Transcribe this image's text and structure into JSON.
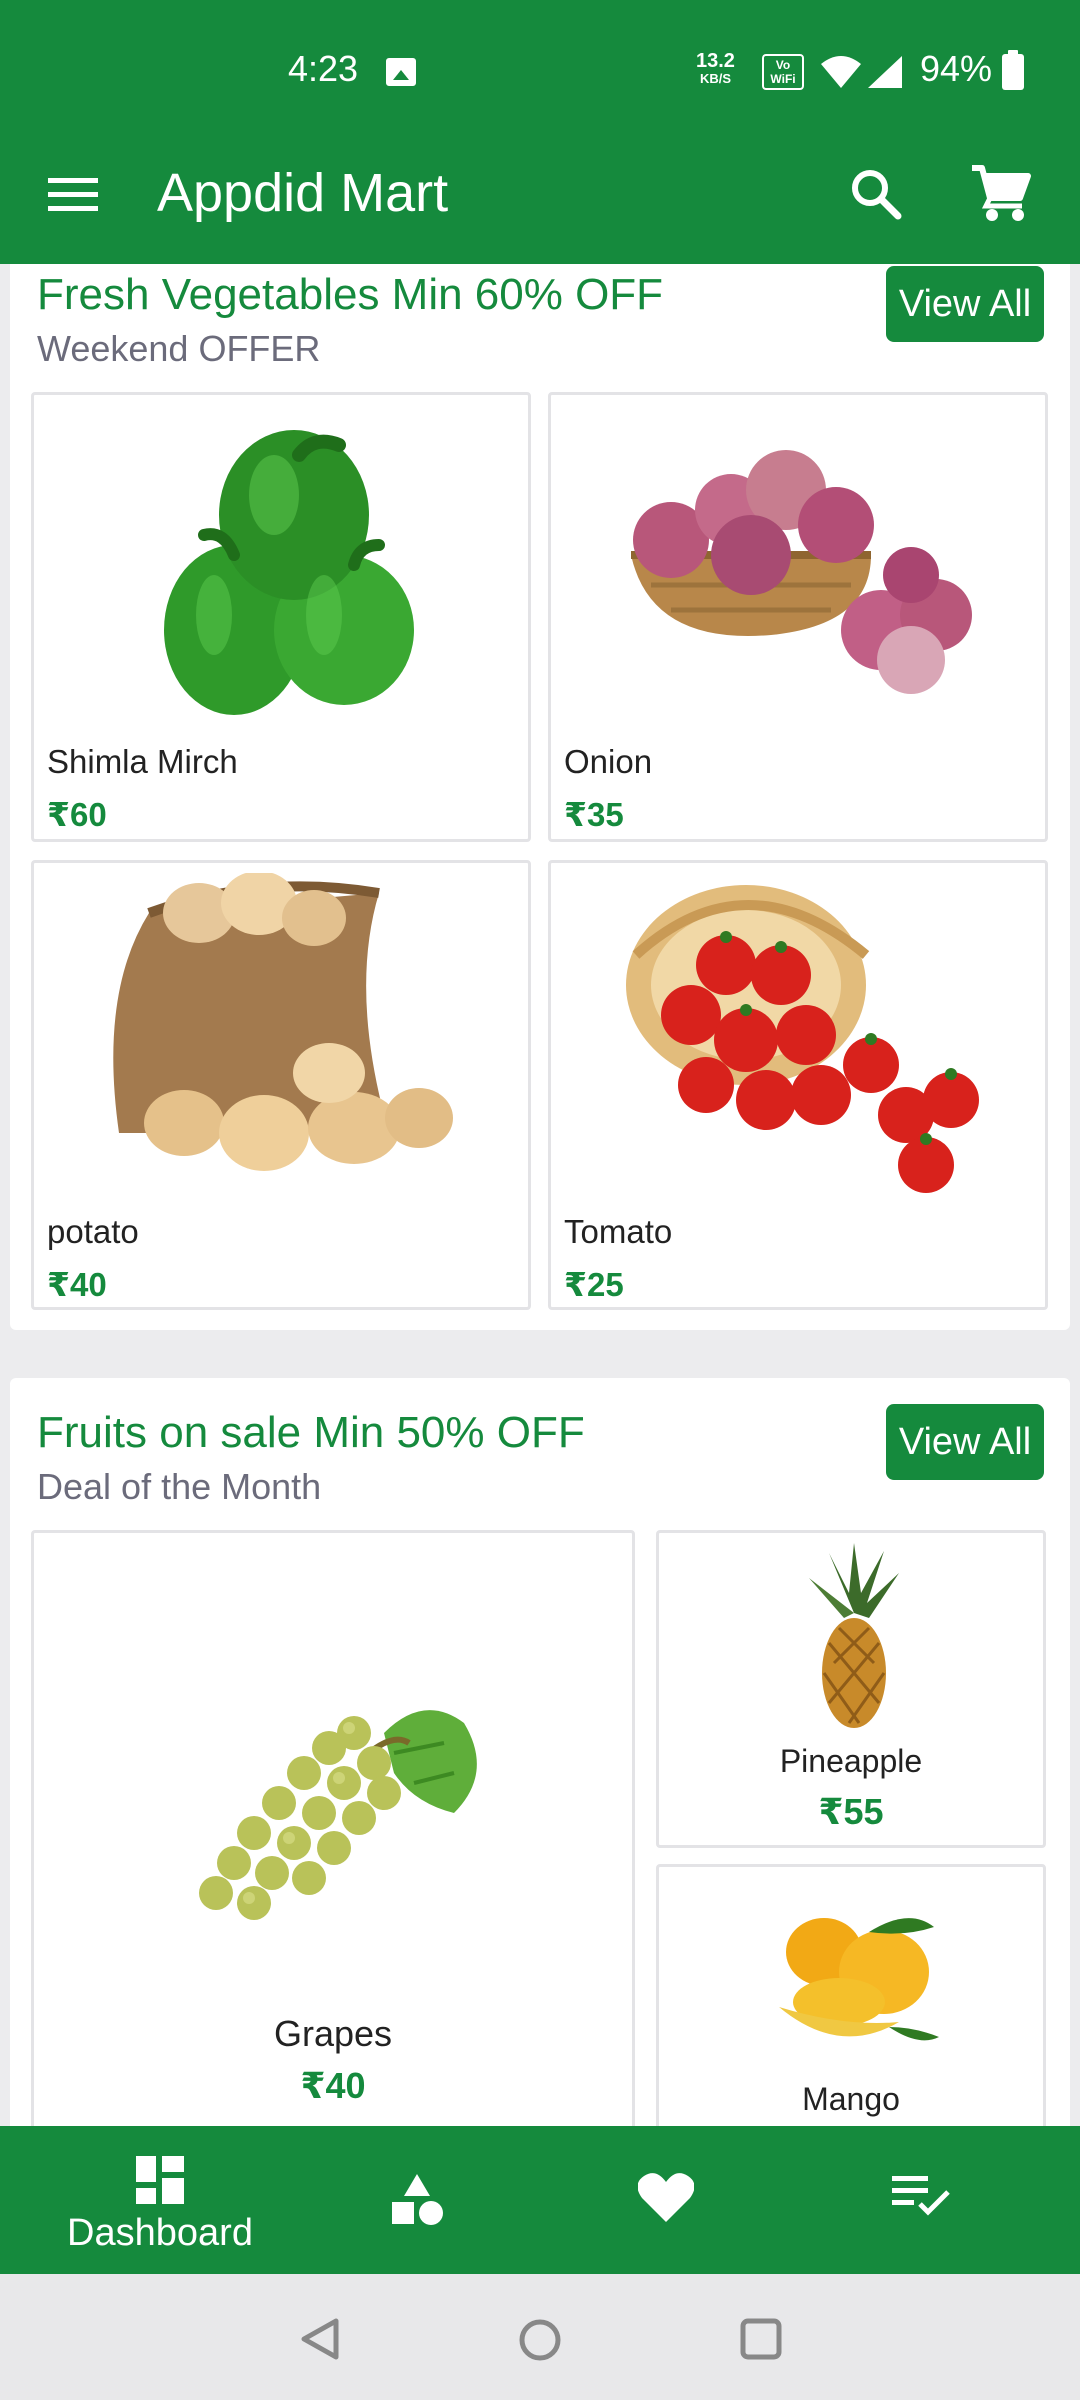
{
  "status_bar": {
    "time": "4:23",
    "net_speed_value": "13.2",
    "net_speed_unit": "KB/S",
    "wifi_badge": "Vo WiFi",
    "battery": "94%"
  },
  "app_bar": {
    "title": "Appdid Mart",
    "icons": [
      "menu-icon",
      "search-icon",
      "cart-icon"
    ]
  },
  "sections": [
    {
      "title": "Fresh Vegetables Min 60% OFF",
      "subtitle": "Weekend OFFER",
      "view_all": "View All",
      "products": [
        {
          "name": "Shimla Mirch",
          "price": "₹60"
        },
        {
          "name": "Onion",
          "price": "₹35"
        },
        {
          "name": "potato",
          "price": "₹40"
        },
        {
          "name": "Tomato",
          "price": "₹25"
        }
      ]
    },
    {
      "title": "Fruits on sale Min 50% OFF",
      "subtitle": "Deal of the Month",
      "view_all": "View All",
      "products": [
        {
          "name": "Grapes",
          "price": "₹40"
        },
        {
          "name": "Pineapple",
          "price": "₹55"
        },
        {
          "name": "Mango",
          "price": ""
        }
      ]
    }
  ],
  "bottom_nav": {
    "items": [
      {
        "icon": "dashboard-icon",
        "label": "Dashboard",
        "active": true
      },
      {
        "icon": "categories-icon",
        "label": ""
      },
      {
        "icon": "heart-icon",
        "label": ""
      },
      {
        "icon": "orders-icon",
        "label": ""
      }
    ]
  },
  "system_nav": [
    "back-icon",
    "home-icon",
    "recents-icon"
  ],
  "colors": {
    "primary": "#158a3d",
    "subtitle": "#6b6b7b",
    "background": "#ececee"
  }
}
